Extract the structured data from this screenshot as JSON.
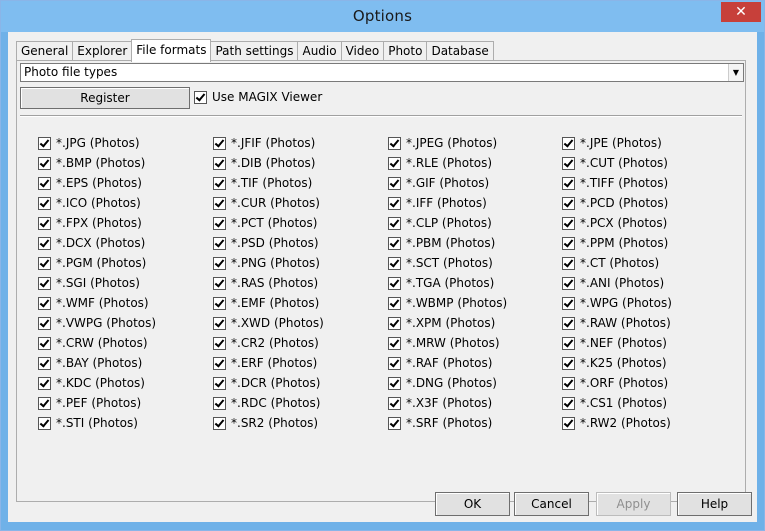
{
  "window": {
    "title": "Options",
    "close": "✕"
  },
  "tabs": [
    "General",
    "Explorer",
    "File formats",
    "Path settings",
    "Audio",
    "Video",
    "Photo",
    "Database"
  ],
  "combo": {
    "value": "Photo file types"
  },
  "register_label": "Register",
  "viewer_label": "Use MAGIX Viewer",
  "formats": [
    [
      "*.JPG (Photos)",
      "*.JFIF (Photos)",
      "*.JPEG (Photos)",
      "*.JPE (Photos)"
    ],
    [
      "*.BMP (Photos)",
      "*.DIB (Photos)",
      "*.RLE (Photos)",
      "*.CUT (Photos)"
    ],
    [
      "*.EPS (Photos)",
      "*.TIF (Photos)",
      "*.GIF (Photos)",
      "*.TIFF (Photos)"
    ],
    [
      "*.ICO (Photos)",
      "*.CUR (Photos)",
      "*.IFF (Photos)",
      "*.PCD (Photos)"
    ],
    [
      "*.FPX (Photos)",
      "*.PCT (Photos)",
      "*.CLP (Photos)",
      "*.PCX (Photos)"
    ],
    [
      "*.DCX (Photos)",
      "*.PSD (Photos)",
      "*.PBM (Photos)",
      "*.PPM (Photos)"
    ],
    [
      "*.PGM (Photos)",
      "*.PNG (Photos)",
      "*.SCT (Photos)",
      "*.CT (Photos)"
    ],
    [
      "*.SGI (Photos)",
      "*.RAS (Photos)",
      "*.TGA (Photos)",
      "*.ANI (Photos)"
    ],
    [
      "*.WMF (Photos)",
      "*.EMF (Photos)",
      "*.WBMP (Photos)",
      "*.WPG (Photos)"
    ],
    [
      "*.VWPG (Photos)",
      "*.XWD (Photos)",
      "*.XPM (Photos)",
      "*.RAW (Photos)"
    ],
    [
      "*.CRW (Photos)",
      "*.CR2 (Photos)",
      "*.MRW (Photos)",
      "*.NEF (Photos)"
    ],
    [
      "*.BAY (Photos)",
      "*.ERF (Photos)",
      "*.RAF (Photos)",
      "*.K25 (Photos)"
    ],
    [
      "*.KDC (Photos)",
      "*.DCR (Photos)",
      "*.DNG (Photos)",
      "*.ORF (Photos)"
    ],
    [
      "*.PEF (Photos)",
      "*.RDC (Photos)",
      "*.X3F (Photos)",
      "*.CS1 (Photos)"
    ],
    [
      "*.STI (Photos)",
      "*.SR2 (Photos)",
      "*.SRF (Photos)",
      "*.RW2 (Photos)"
    ]
  ],
  "buttons": {
    "ok": "OK",
    "cancel": "Cancel",
    "apply": "Apply",
    "help": "Help"
  }
}
